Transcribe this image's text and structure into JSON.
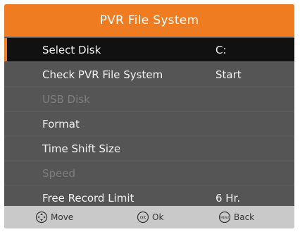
{
  "dialog": {
    "title": "PVR File System"
  },
  "menu": [
    {
      "label": "Select Disk",
      "value": "C:"
    },
    {
      "label": "Check PVR File System",
      "value": "Start"
    },
    {
      "label": "USB Disk",
      "value": ""
    },
    {
      "label": "Format",
      "value": ""
    },
    {
      "label": "Time Shift Size",
      "value": ""
    },
    {
      "label": "Speed",
      "value": ""
    },
    {
      "label": "Free Record Limit",
      "value": "6 Hr."
    }
  ],
  "footer": {
    "move": "Move",
    "ok": "Ok",
    "back": "Back",
    "ok_icon_text": "OK",
    "back_icon_text": "MENU"
  },
  "colors": {
    "title_bg": "#f07c22",
    "panel_bg": "#555555",
    "selected_bg": "#111111",
    "disabled_text": "#7d7d7d",
    "footer_bg": "#c9c9c9"
  }
}
